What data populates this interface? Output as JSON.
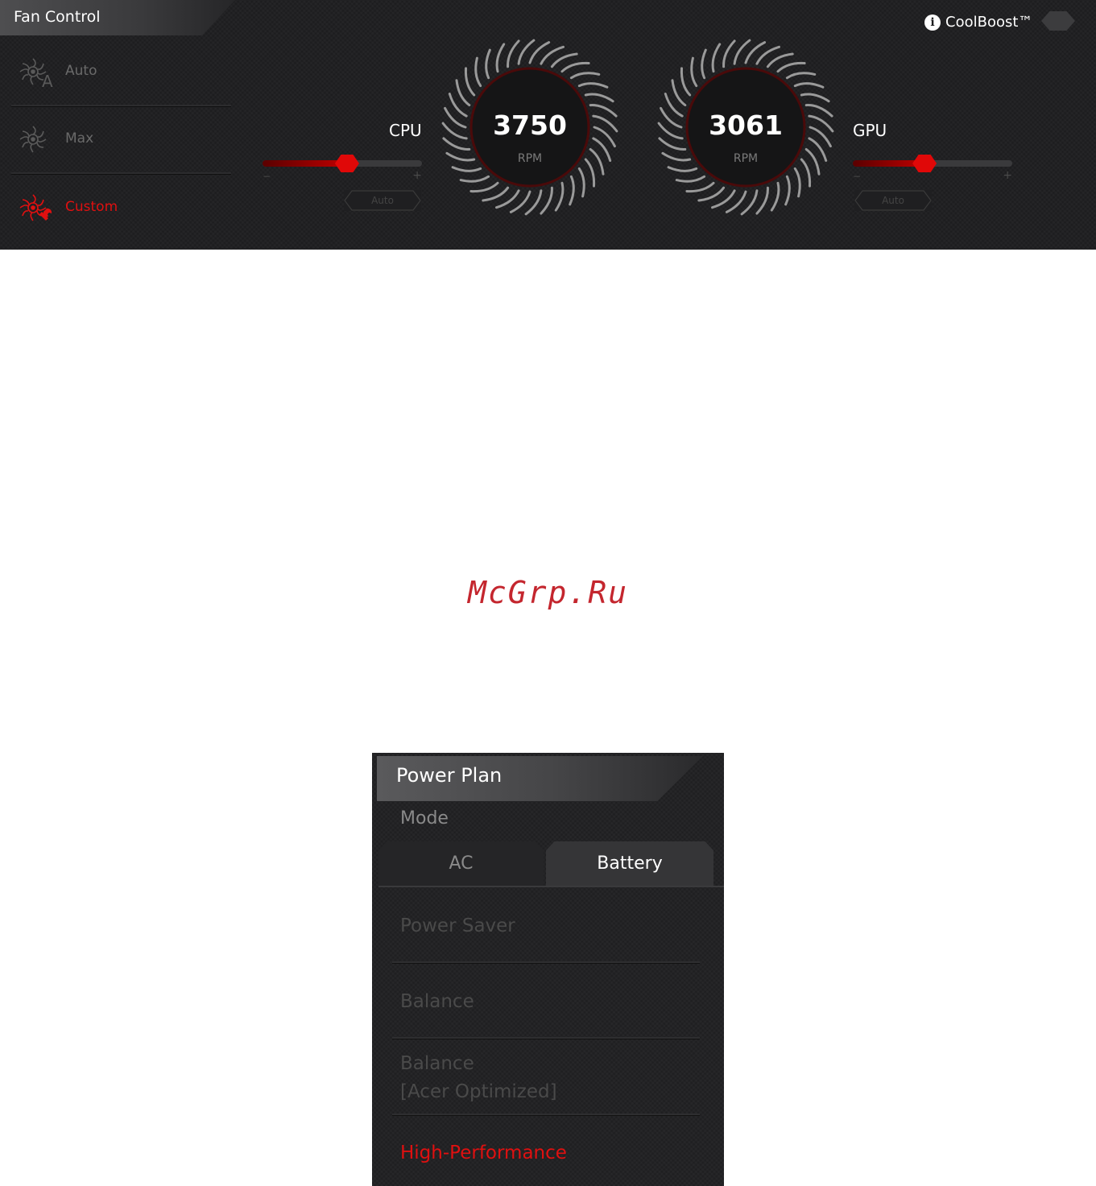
{
  "fan_control": {
    "title": "Fan Control",
    "modes": [
      {
        "label": "Auto",
        "icon": "fan-auto-icon",
        "active": false
      },
      {
        "label": "Max",
        "icon": "fan-max-icon",
        "active": false
      },
      {
        "label": "Custom",
        "icon": "fan-custom-icon",
        "active": true
      }
    ],
    "cpu": {
      "label": "CPU",
      "rpm": "3750",
      "unit": "RPM",
      "slider_level": 0.53,
      "auto_label": "Auto",
      "minus": "−",
      "plus": "+"
    },
    "gpu": {
      "label": "GPU",
      "rpm": "3061",
      "unit": "RPM",
      "slider_level": 0.45,
      "auto_label": "Auto",
      "minus": "−",
      "plus": "+"
    },
    "coolboost": {
      "label": "CoolBoost™",
      "info_icon": "i",
      "enabled": false
    }
  },
  "watermark": "McGrp.Ru",
  "power_plan": {
    "title": "Power Plan",
    "mode_label": "Mode",
    "tabs": [
      {
        "label": "AC",
        "active": false
      },
      {
        "label": "Battery",
        "active": true
      }
    ],
    "plans": [
      {
        "line1": "Power Saver",
        "line2": "",
        "active": false
      },
      {
        "line1": "Balance",
        "line2": "",
        "active": false
      },
      {
        "line1": "Balance",
        "line2": "[Acer Optimized]",
        "active": false
      },
      {
        "line1": "High-Performance",
        "line2": "",
        "active": true
      }
    ]
  },
  "colors": {
    "accent": "#e01010",
    "panel_bg": "#1d1d1f",
    "inactive_text": "#4a4a4a"
  }
}
